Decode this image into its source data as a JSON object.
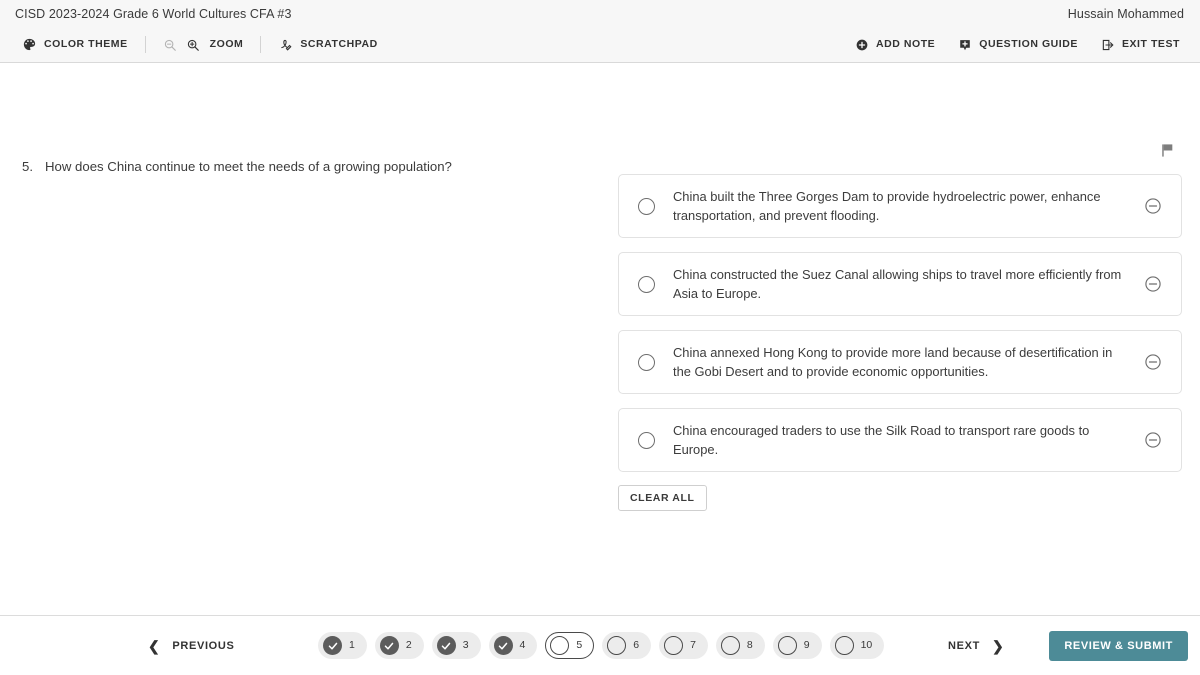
{
  "header": {
    "test_title": "CISD 2023-2024 Grade 6 World Cultures CFA #3",
    "user_name": "Hussain Mohammed"
  },
  "toolbar": {
    "left_items": [
      {
        "label": "COLOR THEME",
        "icon": "palette-icon"
      },
      {
        "label": "ZOOM",
        "icon_out": "zoom-out-icon",
        "icon_in": "zoom-in-icon"
      },
      {
        "label": "SCRATCHPAD",
        "icon": "scratchpad-icon"
      }
    ],
    "right_items": [
      {
        "label": "ADD NOTE",
        "icon": "add-note-icon"
      },
      {
        "label": "QUESTION GUIDE",
        "icon": "question-guide-icon"
      },
      {
        "label": "EXIT TEST",
        "icon": "exit-test-icon"
      }
    ]
  },
  "question": {
    "number": "5.",
    "stem": "How does China continue to meet the needs of a growing population?",
    "flag_icon": "flag-icon",
    "options": [
      {
        "text": "China built the Three Gorges Dam to provide hydroelectric power, enhance transportation, and prevent flooding.",
        "selected": false,
        "eliminated": false
      },
      {
        "text": "China constructed the Suez Canal allowing ships to travel more efficiently from Asia to Europe.",
        "selected": false,
        "eliminated": false
      },
      {
        "text": "China annexed Hong Kong to provide more land because of desertification in the Gobi Desert and to provide economic opportunities.",
        "selected": false,
        "eliminated": false
      },
      {
        "text": "China encouraged traders to use the Silk Road to transport rare goods to Europe.",
        "selected": false,
        "eliminated": false
      }
    ],
    "clear_all_label": "CLEAR ALL"
  },
  "footer": {
    "previous_label": "PREVIOUS",
    "next_label": "NEXT",
    "review_submit_label": "REVIEW & SUBMIT",
    "questions": [
      {
        "number": "1",
        "state": "answered"
      },
      {
        "number": "2",
        "state": "answered"
      },
      {
        "number": "3",
        "state": "answered"
      },
      {
        "number": "4",
        "state": "answered"
      },
      {
        "number": "5",
        "state": "current"
      },
      {
        "number": "6",
        "state": "unanswered"
      },
      {
        "number": "7",
        "state": "unanswered"
      },
      {
        "number": "8",
        "state": "unanswered"
      },
      {
        "number": "9",
        "state": "unanswered"
      },
      {
        "number": "10",
        "state": "unanswered"
      }
    ]
  },
  "colors": {
    "accent_teal": "#4d8b97",
    "header_bg": "#f7f7f7",
    "text": "#3c3c3c",
    "pill_bg": "#ececec",
    "pill_done": "#5c5c5c"
  }
}
